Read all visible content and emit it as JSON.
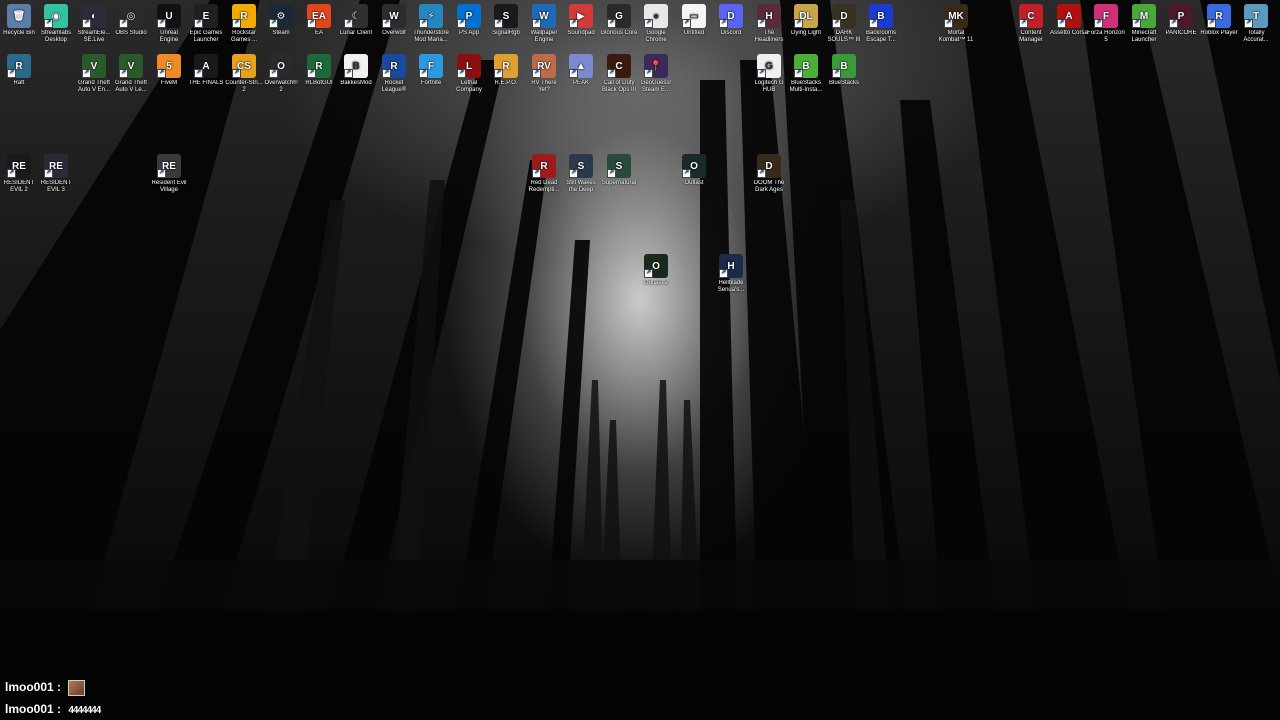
{
  "desktop": {
    "row1": [
      {
        "label": "Recycle Bin",
        "icon": "recycle-bin-icon",
        "color": "#5a7ea8",
        "glyph": "🗑"
      },
      {
        "label": "Streamlabs Desktop",
        "icon": "streamlabs-icon",
        "color": "#31c3a2",
        "glyph": "◉"
      },
      {
        "label": "StreamEle... SE.Live",
        "icon": "streamelements-icon",
        "color": "#2b2b3a",
        "glyph": "◐"
      },
      {
        "label": "OBS Studio",
        "icon": "obs-icon",
        "color": "#2a2a2a",
        "glyph": "◎"
      },
      {
        "label": "Unreal Engine",
        "icon": "unreal-engine-icon",
        "color": "#111111",
        "glyph": "U"
      },
      {
        "label": "Epic Games Launcher",
        "icon": "epic-games-icon",
        "color": "#202020",
        "glyph": "E"
      },
      {
        "label": "Rockstar Games ...",
        "icon": "rockstar-icon",
        "color": "#f2a900",
        "glyph": "R"
      },
      {
        "label": "Steam",
        "icon": "steam-icon",
        "color": "#1b2838",
        "glyph": "⚙"
      },
      {
        "label": "EA",
        "icon": "ea-icon",
        "color": "#e2461a",
        "glyph": "EA"
      },
      {
        "label": "Lunar Client",
        "icon": "lunar-client-icon",
        "color": "#303030",
        "glyph": "☾"
      },
      {
        "label": "Overwolf",
        "icon": "overwolf-icon",
        "color": "#2c2c2c",
        "glyph": "W"
      },
      {
        "label": "Thunderstore Mod Mana...",
        "icon": "thunderstore-icon",
        "color": "#2487c0",
        "glyph": "⚡"
      },
      {
        "label": "PS App",
        "icon": "ps-app-icon",
        "color": "#0070d1",
        "glyph": "P"
      },
      {
        "label": "SignalRgb",
        "icon": "signalrgb-icon",
        "color": "#1a1a1a",
        "glyph": "S"
      },
      {
        "label": "Wallpaper Engine",
        "icon": "wallpaper-engine-icon",
        "color": "#1e6ab8",
        "glyph": "W"
      },
      {
        "label": "Soundpad",
        "icon": "soundpad-icon",
        "color": "#d33a3a",
        "glyph": "▶"
      },
      {
        "label": "Glorious Core",
        "icon": "glorious-core-icon",
        "color": "#2a2a2a",
        "glyph": "G"
      },
      {
        "label": "Google Chrome",
        "icon": "chrome-icon",
        "color": "#e8e8e8",
        "glyph": "●"
      },
      {
        "label": "Untitled",
        "icon": "document-icon",
        "color": "#f5f5f5",
        "glyph": "▭"
      },
      {
        "label": "Discord",
        "icon": "discord-icon",
        "color": "#5865f2",
        "glyph": "D"
      },
      {
        "label": "The Headliners",
        "icon": "the-headliners-icon",
        "color": "#5a2a3a",
        "glyph": "H"
      },
      {
        "label": "Dying Light",
        "icon": "dying-light-icon",
        "color": "#c9a54a",
        "glyph": "DL"
      },
      {
        "label": "DARK SOULS™ III",
        "icon": "dark-souls-icon",
        "color": "#3a3220",
        "glyph": "D"
      },
      {
        "label": "Backrooms Escape T...",
        "icon": "backrooms-icon",
        "color": "#1a3ad0",
        "glyph": "B"
      }
    ],
    "row1_right": [
      {
        "label": "Mortal Kombat™ 11",
        "icon": "mortal-kombat-icon",
        "color": "#3a2a1a",
        "glyph": "MK"
      },
      {
        "label": "Content Manager",
        "icon": "content-manager-icon",
        "color": "#c0202a",
        "glyph": "C"
      },
      {
        "label": "Assetto Corsa",
        "icon": "assetto-corsa-icon",
        "color": "#b01010",
        "glyph": "A"
      },
      {
        "label": "Forza Horizon 5",
        "icon": "forza-icon",
        "color": "#d0307a",
        "glyph": "F"
      },
      {
        "label": "Minecraft Launcher",
        "icon": "minecraft-icon",
        "color": "#4aa83a",
        "glyph": "M"
      },
      {
        "label": "PANICORE",
        "icon": "panicore-icon",
        "color": "#4a1a2a",
        "glyph": "P"
      },
      {
        "label": "Roblox Player",
        "icon": "roblox-icon",
        "color": "#3a6adf",
        "glyph": "R"
      },
      {
        "label": "Totally Accurat...",
        "icon": "tabs-icon",
        "color": "#5a9ac0",
        "glyph": "T"
      }
    ],
    "row2": [
      {
        "label": "Raft",
        "icon": "raft-icon",
        "color": "#2a6a8a",
        "glyph": "R"
      },
      {
        "label": "Grand Theft Auto V En...",
        "icon": "gta-v-icon",
        "color": "#2a5a2a",
        "glyph": "V"
      },
      {
        "label": "Grand Theft Auto V Le...",
        "icon": "gta-v-legacy-icon",
        "color": "#2a5a2a",
        "glyph": "V"
      },
      {
        "label": "FiveM",
        "icon": "fivem-icon",
        "color": "#f08a24",
        "glyph": "5"
      },
      {
        "label": "THE FINALS",
        "icon": "the-finals-icon",
        "color": "#1a1a1a",
        "glyph": "A"
      },
      {
        "label": "Counter-Stri... 2",
        "icon": "counter-strike-icon",
        "color": "#e8a020",
        "glyph": "CS"
      },
      {
        "label": "Overwatch® 2",
        "icon": "overwatch-icon",
        "color": "#2a2a2a",
        "glyph": "O"
      },
      {
        "label": "RLBotGUI",
        "icon": "rlbot-icon",
        "color": "#1a6a3a",
        "glyph": "R"
      },
      {
        "label": "BakkesMod",
        "icon": "bakkesmod-icon",
        "color": "#f0f0f0",
        "glyph": "B"
      },
      {
        "label": "Rocket League®",
        "icon": "rocket-league-icon",
        "color": "#1a4aa0",
        "glyph": "R"
      },
      {
        "label": "Fortnite",
        "icon": "fortnite-icon",
        "color": "#2a9ae0",
        "glyph": "F"
      },
      {
        "label": "Lethal Company",
        "icon": "lethal-company-icon",
        "color": "#8a1010",
        "glyph": "L"
      },
      {
        "label": "R.E.P.O.",
        "icon": "repo-icon",
        "color": "#e0a030",
        "glyph": "R"
      },
      {
        "label": "RV There Yet?",
        "icon": "rv-there-yet-icon",
        "color": "#c06a4a",
        "glyph": "RV"
      },
      {
        "label": "PEAK",
        "icon": "peak-icon",
        "color": "#7a8ad0",
        "glyph": "▲"
      },
      {
        "label": "Call of Duty Black Ops III",
        "icon": "call-of-duty-icon",
        "color": "#3a1a10",
        "glyph": "C"
      },
      {
        "label": "GeoGuessr Steam E...",
        "icon": "geoguessr-icon",
        "color": "#3a2a5a",
        "glyph": "📍"
      }
    ],
    "row2_right": [
      {
        "label": "Logitech G HUB",
        "icon": "logitech-icon",
        "color": "#f0f0f0",
        "glyph": "G"
      },
      {
        "label": "BlueStacks Multi-Insta...",
        "icon": "bluestacks-multi-icon",
        "color": "#4ab03a",
        "glyph": "B"
      },
      {
        "label": "BlueStacks",
        "icon": "bluestacks-icon",
        "color": "#3a9a3a",
        "glyph": "B"
      }
    ],
    "row3": [
      {
        "label": "RESIDENT EVIL 2",
        "icon": "resident-evil-2-icon",
        "color": "#1a1a1a",
        "glyph": "RE"
      },
      {
        "label": "RESIDENT EVIL 3",
        "icon": "resident-evil-3-icon",
        "color": "#2a2a3a",
        "glyph": "RE"
      },
      {
        "label": "Resident Evil Village",
        "icon": "resident-evil-village-icon",
        "color": "#3a3a3a",
        "glyph": "RE"
      }
    ],
    "row3_mid": [
      {
        "label": "Red Dead Redempti...",
        "icon": "red-dead-icon",
        "color": "#a01a1a",
        "glyph": "R"
      },
      {
        "label": "Still Wakes the Deep",
        "icon": "still-wakes-icon",
        "color": "#2a3a4a",
        "glyph": "S"
      },
      {
        "label": "Supernatural",
        "icon": "supernatural-icon",
        "color": "#2a4a3a",
        "glyph": "S"
      },
      {
        "label": "Outlast",
        "icon": "outlast-icon",
        "color": "#1a2a2a",
        "glyph": "O"
      },
      {
        "label": "DOOM The Dark Ages",
        "icon": "doom-icon",
        "color": "#3a2a1a",
        "glyph": "D"
      }
    ],
    "row4": [
      {
        "label": "Outlast 2",
        "icon": "outlast-2-icon",
        "color": "#1a2a1a",
        "glyph": "O"
      },
      {
        "label": "Hellblade Senua's...",
        "icon": "hellblade-icon",
        "color": "#1a2a4a",
        "glyph": "H"
      }
    ]
  },
  "chat": [
    {
      "user": "lmoo001",
      "sep": ":",
      "content": "",
      "has_avatar": true
    },
    {
      "user": "lmoo001",
      "sep": ":",
      "content": "4444444",
      "has_avatar": false
    }
  ]
}
